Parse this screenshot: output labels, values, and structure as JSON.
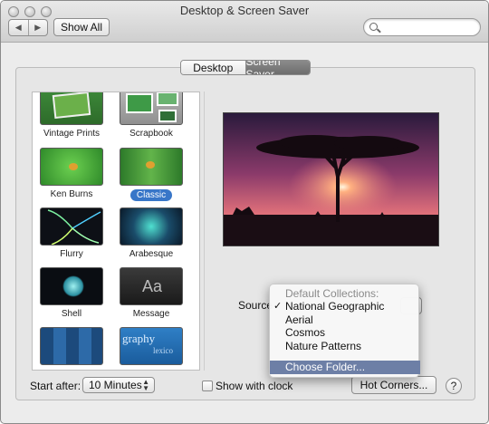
{
  "window": {
    "title": "Desktop & Screen Saver"
  },
  "toolbar": {
    "back_glyph": "◀",
    "forward_glyph": "▶",
    "show_all_label": "Show All",
    "search_value": ""
  },
  "tabs": [
    {
      "label": "Desktop",
      "selected": false
    },
    {
      "label": "Screen Saver",
      "selected": true
    }
  ],
  "savers": [
    {
      "label": "Vintage Prints",
      "icon": "vintage-prints-thumbnail",
      "selected": false
    },
    {
      "label": "Scrapbook",
      "icon": "scrapbook-thumbnail",
      "selected": false
    },
    {
      "label": "Ken Burns",
      "icon": "ken-burns-thumbnail",
      "selected": false
    },
    {
      "label": "Classic",
      "icon": "classic-thumbnail",
      "selected": true
    },
    {
      "label": "Flurry",
      "icon": "flurry-thumbnail",
      "selected": false
    },
    {
      "label": "Arabesque",
      "icon": "arabesque-thumbnail",
      "selected": false
    },
    {
      "label": "Shell",
      "icon": "shell-thumbnail",
      "selected": false
    },
    {
      "label": "Message",
      "icon": "message-thumbnail",
      "thumb_text": "Aa",
      "selected": false
    },
    {
      "label": "",
      "icon": "photo-wall-thumbnail",
      "selected": false
    },
    {
      "label": "",
      "icon": "word-of-the-day-thumbnail",
      "thumb_text": "graphy",
      "thumb_text2": "lexico",
      "selected": false
    }
  ],
  "source": {
    "label": "Source",
    "menu": {
      "header": "Default Collections:",
      "items": [
        {
          "label": "National Geographic",
          "checked": true
        },
        {
          "label": "Aerial",
          "checked": false
        },
        {
          "label": "Cosmos",
          "checked": false
        },
        {
          "label": "Nature Patterns",
          "checked": false
        }
      ],
      "choose_folder": "Choose Folder...",
      "checkmark": "✓"
    }
  },
  "bottom": {
    "start_after_label": "Start after:",
    "start_after_value": "10 Minutes",
    "show_clock_label": "Show with clock",
    "show_clock_checked": false,
    "hot_corners_label": "Hot Corners...",
    "help_label": "?"
  }
}
